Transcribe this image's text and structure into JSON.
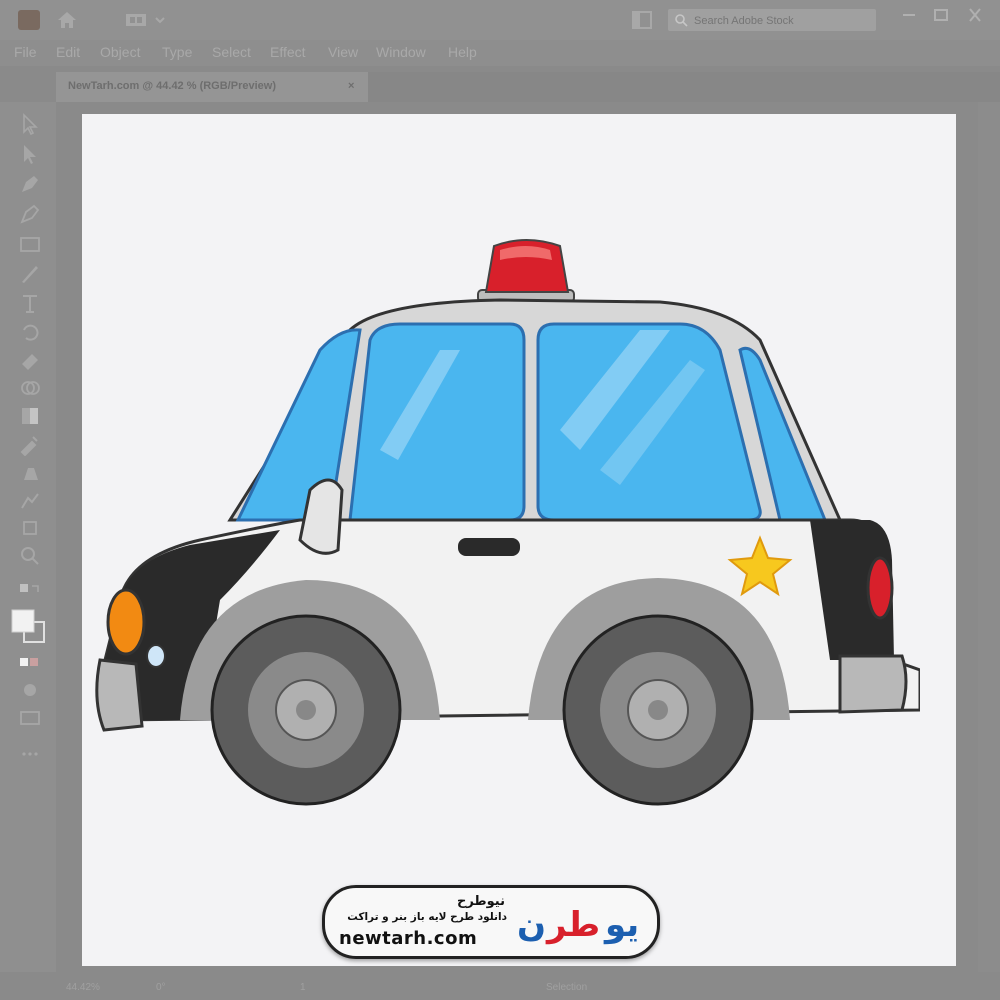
{
  "window": {
    "search_placeholder": "Search Adobe Stock"
  },
  "menu": [
    "File",
    "Edit",
    "Object",
    "Type",
    "Select",
    "Effect",
    "View",
    "Window",
    "Help"
  ],
  "document_tab": {
    "title": "NewTarh.com @ 44.42 % (RGB/Preview)",
    "close": "×"
  },
  "status": {
    "zoom": "44.42%",
    "rotation": "0°",
    "artboard": "1",
    "tool": "Selection"
  },
  "watermark": {
    "brand_persian": "نیوطرح",
    "tagline": "دانلود طرح لایه باز بنر و تراکت",
    "url": "newtarh.com",
    "logo_text": "نیوطرح"
  },
  "colors": {
    "siren": "#d8202b",
    "glass": "#4ab6ef",
    "body": "#f2f2f2",
    "black": "#2a2a2a",
    "star": "#f7c81e",
    "headlight": "#f28a12",
    "logo_red": "#d8202b",
    "logo_blue": "#1c5fb0"
  }
}
